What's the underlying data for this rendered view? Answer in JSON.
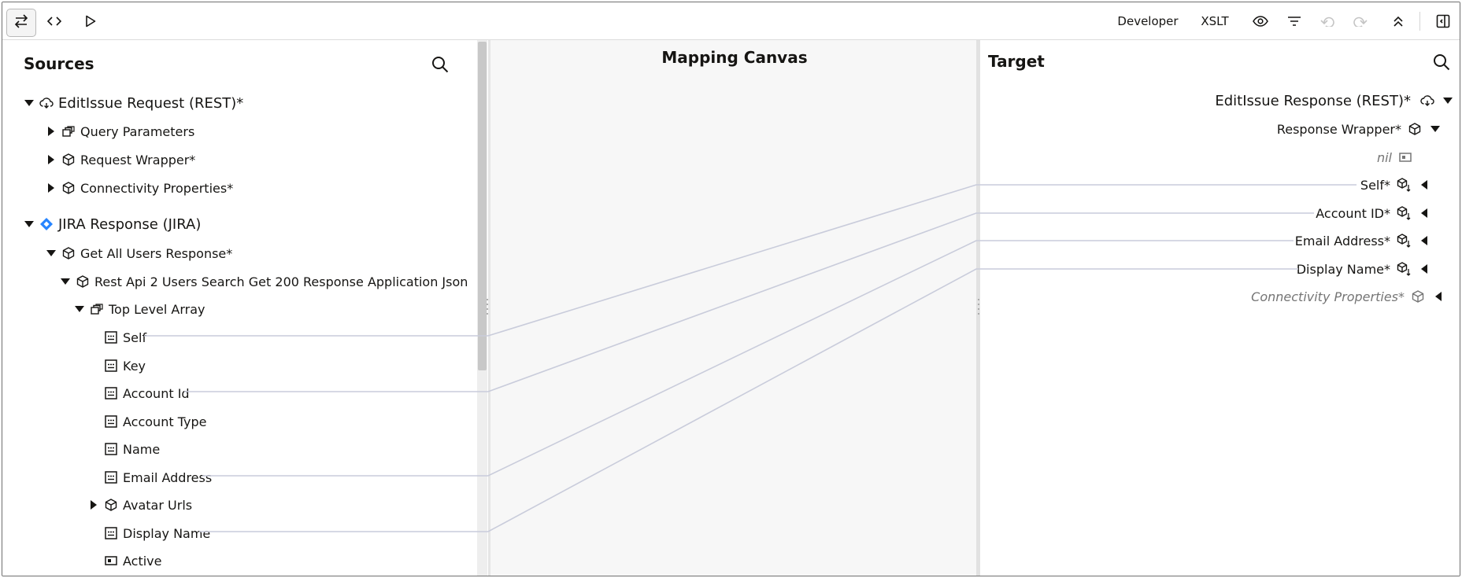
{
  "toolbar": {
    "developer_label": "Developer",
    "xslt_label": "XSLT",
    "icons": [
      "swap-icon",
      "code-icon",
      "play-icon",
      "eye-icon",
      "filter-icon",
      "undo-icon",
      "redo-icon",
      "collapse-all-icon",
      "panel-toggle-icon"
    ]
  },
  "sources": {
    "title": "Sources",
    "tree": [
      {
        "label": "EditIssue Request (REST)*",
        "icon": "rest-cloud-icon",
        "expanded": true,
        "level": 0
      },
      {
        "label": "Query Parameters",
        "icon": "array-icon",
        "expanded": false,
        "level": 1
      },
      {
        "label": "Request Wrapper*",
        "icon": "object-icon",
        "expanded": false,
        "level": 1
      },
      {
        "label": "Connectivity Properties*",
        "icon": "object-icon",
        "expanded": false,
        "level": 1
      },
      {
        "label": "JIRA Response (JIRA)",
        "icon": "jira-icon",
        "expanded": true,
        "level": 0
      },
      {
        "label": "Get All Users Response*",
        "icon": "object-icon",
        "expanded": true,
        "level": 1
      },
      {
        "label": "Rest Api 2 Users Search Get 200 Response Application Json",
        "icon": "object-icon",
        "expanded": true,
        "level": 2
      },
      {
        "label": "Top Level Array",
        "icon": "array-icon",
        "expanded": true,
        "level": 3
      },
      {
        "label": "Self",
        "icon": "string-icon",
        "level": 4
      },
      {
        "label": "Key",
        "icon": "string-icon",
        "level": 4
      },
      {
        "label": "Account Id",
        "icon": "string-icon",
        "level": 4
      },
      {
        "label": "Account Type",
        "icon": "string-icon",
        "level": 4
      },
      {
        "label": "Name",
        "icon": "string-icon",
        "level": 4
      },
      {
        "label": "Email Address",
        "icon": "string-icon",
        "level": 4
      },
      {
        "label": "Avatar Urls",
        "icon": "object-icon",
        "expanded": false,
        "level": 4
      },
      {
        "label": "Display Name",
        "icon": "string-icon",
        "level": 4
      },
      {
        "label": "Active",
        "icon": "boolean-icon",
        "level": 4
      }
    ]
  },
  "canvas": {
    "title": "Mapping Canvas"
  },
  "target": {
    "title": "Target",
    "tree": [
      {
        "label": "EditIssue Response (REST)*",
        "icon": "rest-cloud-icon"
      },
      {
        "label": "Response Wrapper*",
        "icon": "object-icon"
      },
      {
        "label": "nil",
        "icon": "attribute-icon"
      },
      {
        "label": "Self*",
        "icon": "object-mapped-icon"
      },
      {
        "label": "Account ID*",
        "icon": "object-mapped-icon"
      },
      {
        "label": "Email Address*",
        "icon": "object-mapped-icon"
      },
      {
        "label": "Display Name*",
        "icon": "object-mapped-icon"
      },
      {
        "label": "Connectivity Properties*",
        "icon": "object-icon"
      }
    ]
  },
  "mappings": [
    {
      "source": "Self",
      "target": "Self*"
    },
    {
      "source": "Account Id",
      "target": "Account ID*"
    },
    {
      "source": "Email Address",
      "target": "Email Address*"
    },
    {
      "source": "Display Name",
      "target": "Display Name*"
    }
  ],
  "colors": {
    "mapping_line": "#c9ccdb",
    "jira_blue": "#2684ff",
    "accent": "#161513"
  }
}
